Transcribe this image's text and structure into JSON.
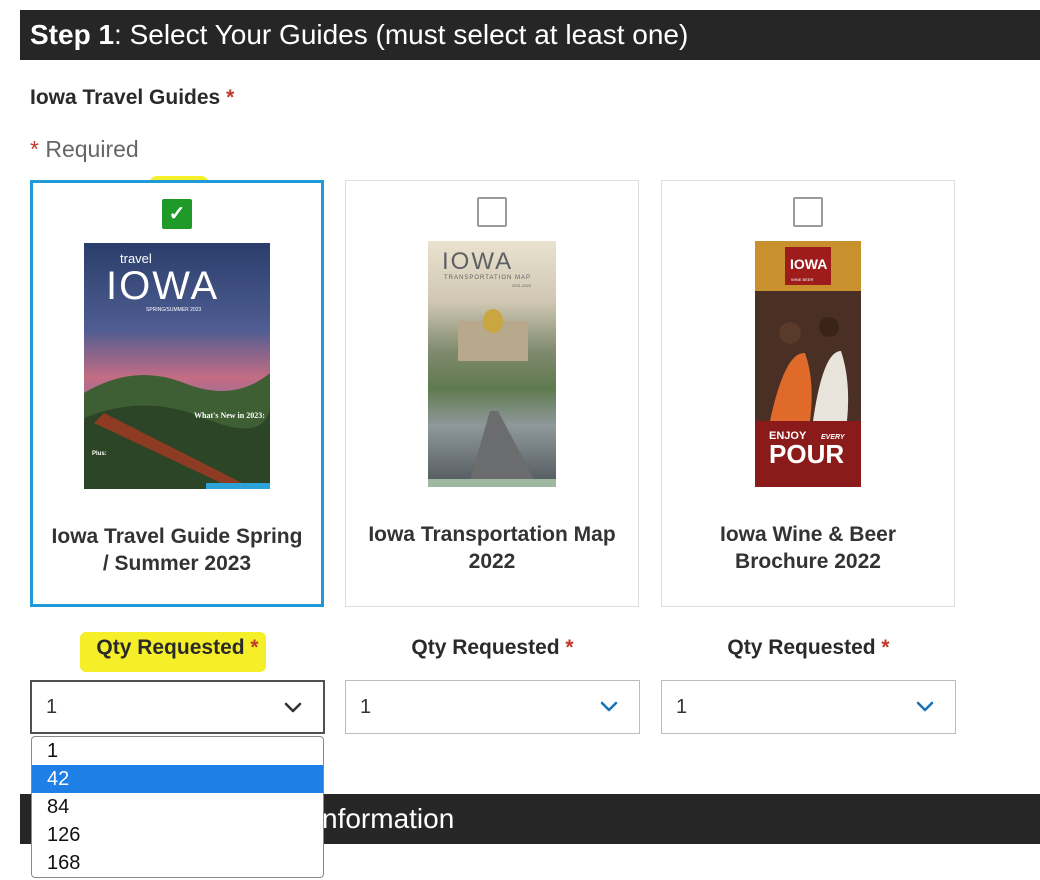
{
  "step": {
    "prefix": "Step 1",
    "title": ": Select Your Guides (must select at least one)"
  },
  "group": {
    "label": "Iowa Travel Guides",
    "star": "*",
    "required_note": "Required"
  },
  "guides": [
    {
      "title": "Iowa Travel Guide Spring / Summer 2023",
      "selected": true,
      "cover": {
        "brand_small": "travel",
        "brand": "IOWA",
        "edition": "SPRING/SUMMER 2023",
        "headline": "What's New in 2023:",
        "plus": "Plus:"
      }
    },
    {
      "title": "Iowa Transportation Map 2022",
      "selected": false,
      "cover": {
        "brand": "IOWA",
        "subtitle": "TRANSPORTATION MAP",
        "years": "2021-2022"
      }
    },
    {
      "title": "Iowa Wine & Beer Brochure 2022",
      "selected": false,
      "cover": {
        "brand": "IOWA",
        "tag": "WINE BEER",
        "enjoy": "ENJOY",
        "every": "EVERY",
        "pour": "POUR"
      }
    }
  ],
  "qty": {
    "label": "Qty Requested",
    "values": [
      "1",
      "1",
      "1"
    ],
    "options": [
      "1",
      "42",
      "84",
      "126",
      "168"
    ],
    "active_option": "42"
  },
  "next_section": {
    "visible_text": "nformation"
  },
  "colors": {
    "header_bg": "#262626",
    "selected_border": "#1e9ad6",
    "checkbox_checked": "#1f9a29",
    "highlight": "#f5ef2a",
    "option_active": "#1e7fe6",
    "required_star": "#c0392b"
  }
}
